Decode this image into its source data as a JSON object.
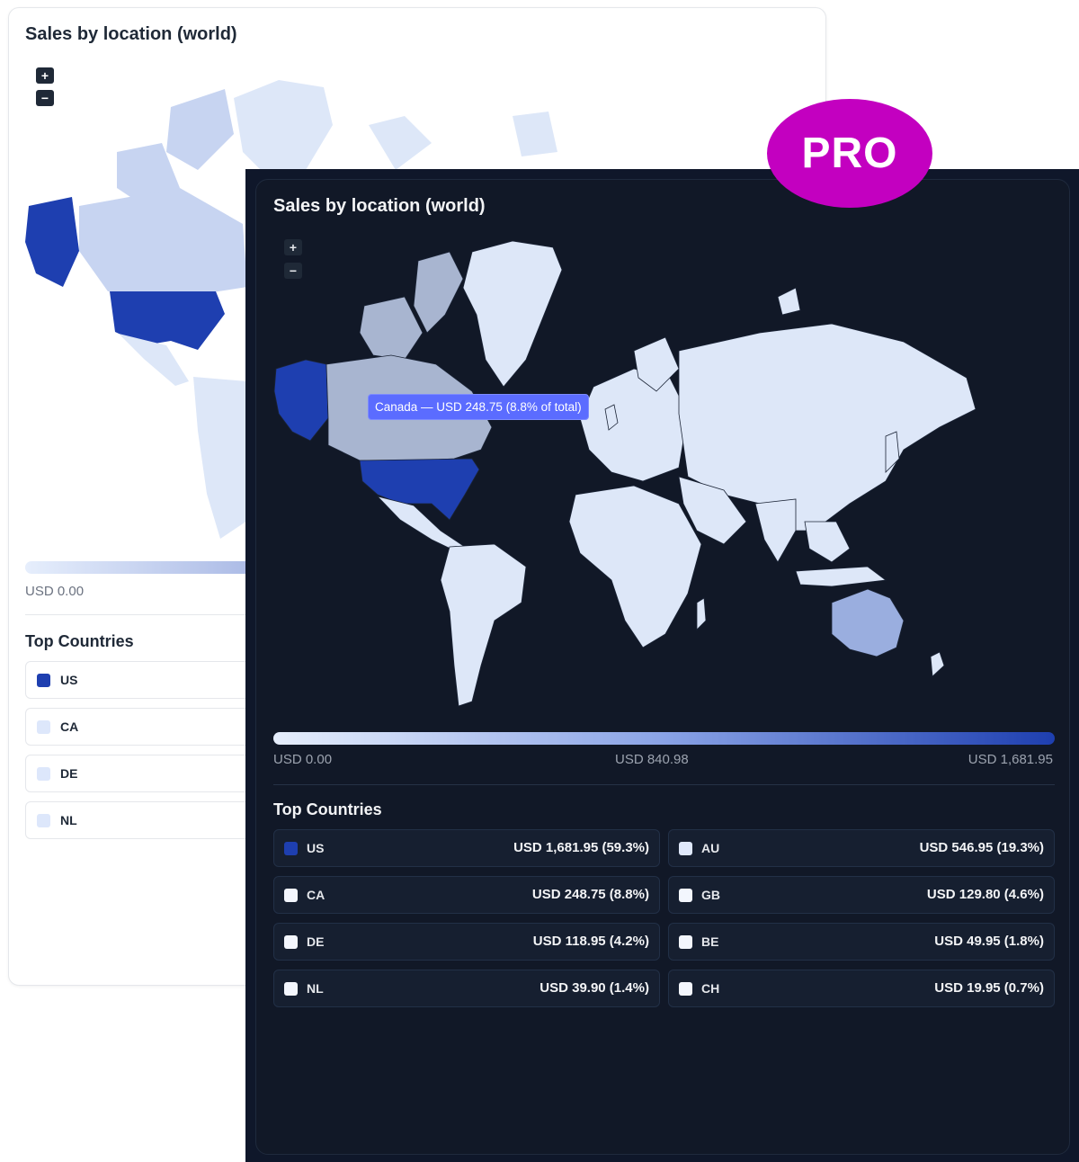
{
  "light_card": {
    "title": "Sales by location (world)",
    "zoom_in": "+",
    "zoom_out": "−",
    "legend_min": "USD 0.00",
    "top_countries_title": "Top Countries",
    "rows": [
      {
        "code": "US",
        "color": "#1e3fb0"
      },
      {
        "code": "CA",
        "color": "#dde7fb"
      },
      {
        "code": "DE",
        "color": "#dde7fb"
      },
      {
        "code": "NL",
        "color": "#dde7fb"
      }
    ]
  },
  "badge": {
    "label": "PRO",
    "color": "#c300c0"
  },
  "dark_card": {
    "title": "Sales by location (world)",
    "zoom_in": "+",
    "zoom_out": "−",
    "tooltip": "Canada — USD 248.75 (8.8% of total)",
    "legend": {
      "min": "USD 0.00",
      "mid": "USD 840.98",
      "max": "USD 1,681.95"
    },
    "top_countries_title": "Top Countries",
    "rows": [
      {
        "code": "US",
        "value": "USD 1,681.95 (59.3%)",
        "color": "#1e3fb0"
      },
      {
        "code": "AU",
        "value": "USD 546.95 (19.3%)",
        "color": "#dfe8fb"
      },
      {
        "code": "CA",
        "value": "USD 248.75 (8.8%)",
        "color": "#f3f6fd"
      },
      {
        "code": "GB",
        "value": "USD 129.80 (4.6%)",
        "color": "#f3f6fd"
      },
      {
        "code": "DE",
        "value": "USD 118.95 (4.2%)",
        "color": "#f3f6fd"
      },
      {
        "code": "BE",
        "value": "USD 49.95 (1.8%)",
        "color": "#f3f6fd"
      },
      {
        "code": "NL",
        "value": "USD 39.90 (1.4%)",
        "color": "#f3f6fd"
      },
      {
        "code": "CH",
        "value": "USD 19.95 (0.7%)",
        "color": "#f3f6fd"
      }
    ]
  },
  "map_colors": {
    "us": "#1e3fb0",
    "au": "#9aaedf",
    "ca": "#a8b5d0",
    "other": "#dde7f8",
    "ocean_dark": "#111827"
  }
}
